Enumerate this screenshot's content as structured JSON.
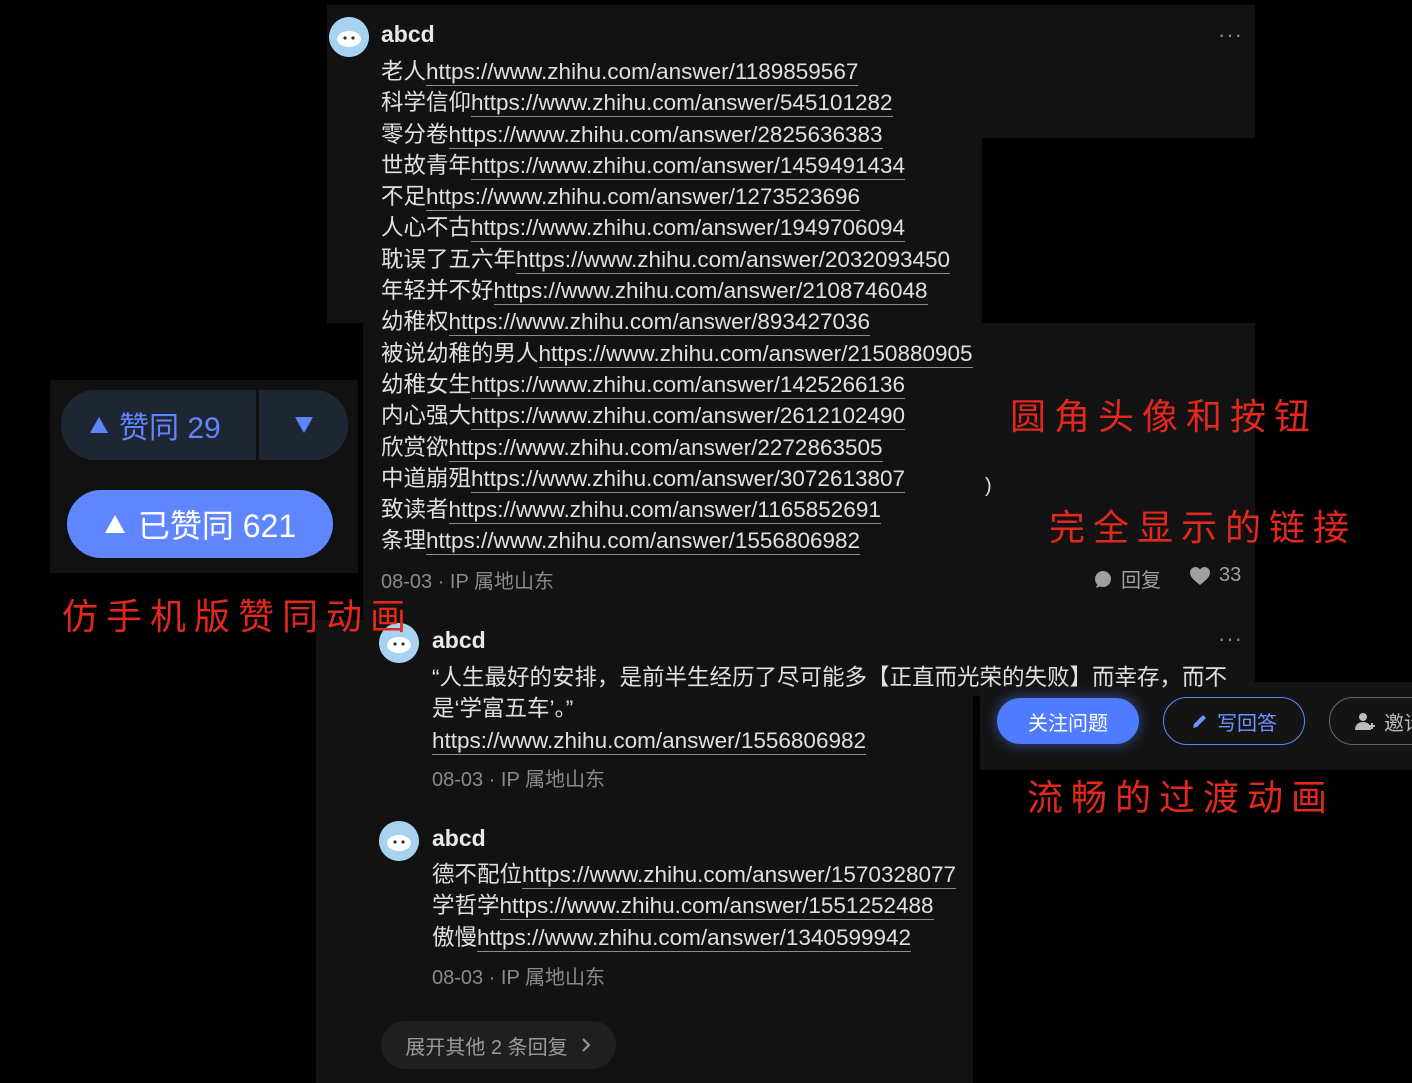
{
  "comment1": {
    "author": "abcd",
    "lines": [
      {
        "prefix": "老人",
        "url": "https://www.zhihu.com/answer/1189859567"
      },
      {
        "prefix": "科学信仰",
        "url": "https://www.zhihu.com/answer/545101282"
      },
      {
        "prefix": "零分卷",
        "url": "https://www.zhihu.com/answer/2825636383"
      },
      {
        "prefix": "世故青年",
        "url": "https://www.zhihu.com/answer/1459491434"
      },
      {
        "prefix": "不足",
        "url": "https://www.zhihu.com/answer/1273523696"
      },
      {
        "prefix": "人心不古",
        "url": "https://www.zhihu.com/answer/1949706094"
      },
      {
        "prefix": "耽误了五六年",
        "url": "https://www.zhihu.com/answer/2032093450"
      },
      {
        "prefix": "年轻并不好",
        "url": "https://www.zhihu.com/answer/2108746048"
      },
      {
        "prefix": "幼稚权",
        "url": "https://www.zhihu.com/answer/893427036"
      },
      {
        "prefix": "被说幼稚的男人",
        "url": "https://www.zhihu.com/answer/2150880905"
      },
      {
        "prefix": "幼稚女生",
        "url": "https://www.zhihu.com/answer/1425266136"
      },
      {
        "prefix": "内心强大",
        "url": "https://www.zhihu.com/answer/2612102490"
      },
      {
        "prefix": "欣赏欲",
        "url": "https://www.zhihu.com/answer/2272863505"
      },
      {
        "prefix": "中道崩殂",
        "url": "https://www.zhihu.com/answer/3072613807"
      },
      {
        "prefix": "致读者",
        "url": "https://www.zhihu.com/answer/1165852691"
      },
      {
        "prefix": "条理",
        "url": "https://www.zhihu.com/answer/1556806982"
      }
    ],
    "meta": "08-03 · IP 属地山东",
    "reply_label": "回复",
    "like_count": "33",
    "more": "···",
    "stray": ")"
  },
  "comment2": {
    "author": "abcd",
    "text_line1": "“人生最好的安排，是前半生经历了尽可能多【正直而光荣的失败】而幸存，而不",
    "text_line2": "是‘学富五车’。”",
    "url": "https://www.zhihu.com/answer/1556806982",
    "meta": "08-03 · IP 属地山东",
    "more": "···"
  },
  "comment3": {
    "author": "abcd",
    "lines": [
      {
        "prefix": "德不配位",
        "url": "https://www.zhihu.com/answer/1570328077"
      },
      {
        "prefix": "学哲学",
        "url": "https://www.zhihu.com/answer/1551252488"
      },
      {
        "prefix": "傲慢",
        "url": "https://www.zhihu.com/answer/1340599942"
      }
    ],
    "meta": "08-03 · IP 属地山东"
  },
  "expand_label": "展开其他 2 条回复",
  "vote": {
    "up_label": "赞同 29",
    "voted_label": "已赞同 621"
  },
  "buttons": {
    "follow": "关注问题",
    "write": "写回答",
    "invite": "邀请"
  },
  "annotations": {
    "vote_anim": "仿手机版赞同动画",
    "rounded": "圆角头像和按钮",
    "full_links": "完全显示的链接",
    "smooth": "流畅的过渡动画"
  },
  "colors": {
    "accent": "#5f86ff",
    "annotation_red": "#e3281d",
    "panel": "#121212"
  }
}
